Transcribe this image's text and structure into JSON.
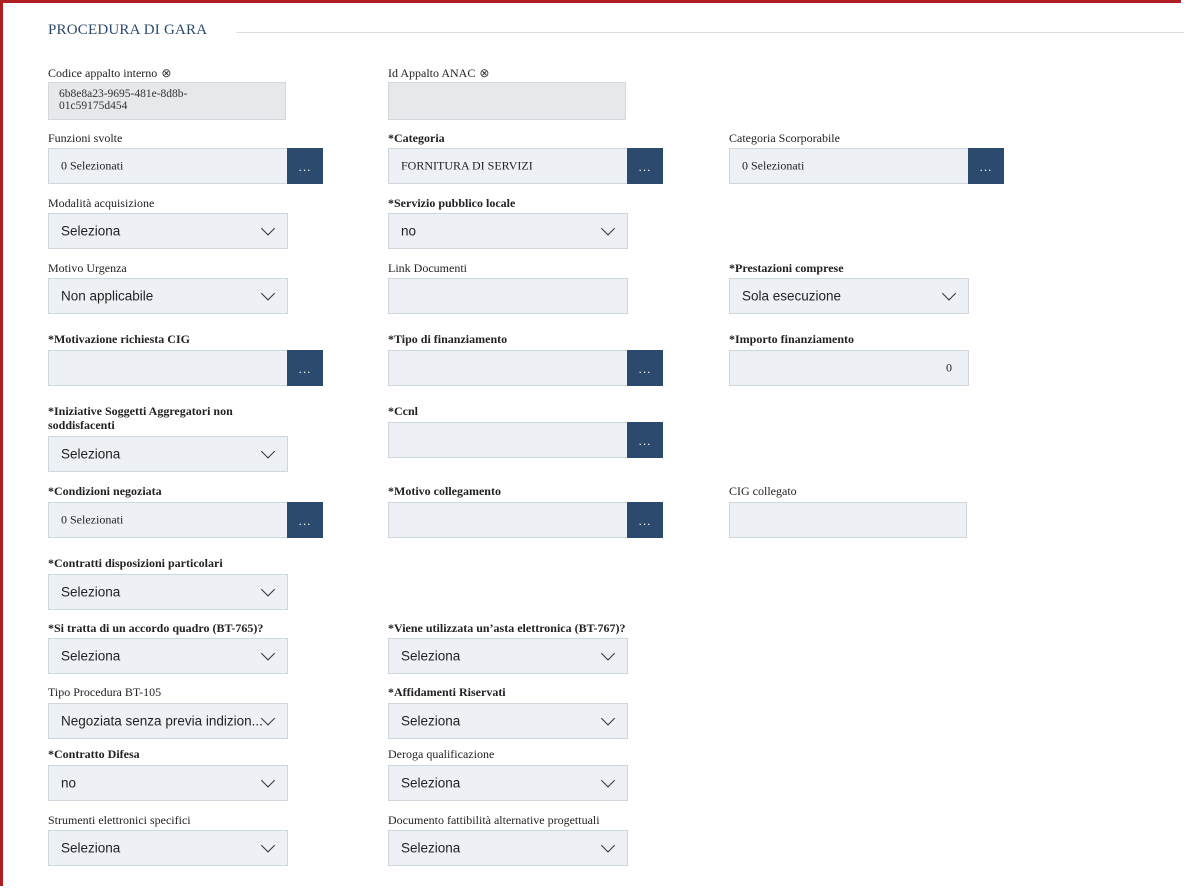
{
  "section": {
    "title": "PROCEDURA DI GARA"
  },
  "icons": {
    "info": "⊗"
  },
  "fields": {
    "codice_appalto": {
      "label": "Codice appalto interno",
      "value_line1": "6b8e8a23-9695-481e-8d8b-",
      "value_line2": "01c59175d454"
    },
    "id_appalto_anac": {
      "label": "Id Appalto ANAC",
      "value": ""
    },
    "funzioni_svolte": {
      "label": "Funzioni svolte",
      "value": "0 Selezionati",
      "button": "..."
    },
    "categoria": {
      "label": "*Categoria",
      "value": "FORNITURA DI SERVIZI",
      "button": "..."
    },
    "categoria_scorporabile": {
      "label": "Categoria Scorporabile",
      "value": "0 Selezionati",
      "button": "..."
    },
    "modalita_acquisizione": {
      "label": "Modalità acquisizione",
      "value": "Seleziona"
    },
    "servizio_pubblico": {
      "label": "*Servizio pubblico locale",
      "value": "no"
    },
    "motivo_urgenza": {
      "label": "Motivo Urgenza",
      "value": "Non applicabile"
    },
    "link_documenti": {
      "label": "Link Documenti",
      "value": ""
    },
    "prestazioni_comprese": {
      "label": "*Prestazioni comprese",
      "value": "Sola esecuzione"
    },
    "motivazione_cig": {
      "label": "*Motivazione richiesta CIG",
      "value": "",
      "button": "..."
    },
    "tipo_finanziamento": {
      "label": "*Tipo di finanziamento",
      "value": "",
      "button": "..."
    },
    "importo_finanziamento": {
      "label": "*Importo finanziamento",
      "value": "0"
    },
    "iniziative_soggetti": {
      "label": "*Iniziative Soggetti Aggregatori non soddisfacenti",
      "value": "Seleziona"
    },
    "ccnl": {
      "label": "*Ccnl",
      "value": "",
      "button": "..."
    },
    "condizioni_negoziata": {
      "label": "*Condizioni negoziata",
      "value": "0 Selezionati",
      "button": "..."
    },
    "motivo_collegamento": {
      "label": "*Motivo collegamento",
      "value": "",
      "button": "..."
    },
    "cig_collegato": {
      "label": "CIG collegato",
      "value": ""
    },
    "contratti_disposizioni": {
      "label": "*Contratti disposizioni particolari",
      "value": "Seleziona"
    },
    "accordo_quadro": {
      "label": "*Si tratta di un accordo quadro (BT-765)?",
      "value": "Seleziona"
    },
    "asta_elettronica": {
      "label": "*Viene utilizzata un’asta elettronica (BT-767)?",
      "value": "Seleziona"
    },
    "tipo_procedura": {
      "label": "Tipo Procedura BT-105",
      "value": "Negoziata senza previa indizion..."
    },
    "affidamenti_riservati": {
      "label": "*Affidamenti Riservati",
      "value": "Seleziona"
    },
    "contratto_difesa": {
      "label": "*Contratto Difesa",
      "value": "no"
    },
    "deroga_qualificazione": {
      "label": "Deroga qualificazione",
      "value": "Seleziona"
    },
    "strumenti_elettronici": {
      "label": "Strumenti elettronici specifici",
      "value": "Seleziona"
    },
    "documento_fattibilita": {
      "label": "Documento fattibilità alternative progettuali",
      "value": "Seleziona"
    }
  }
}
